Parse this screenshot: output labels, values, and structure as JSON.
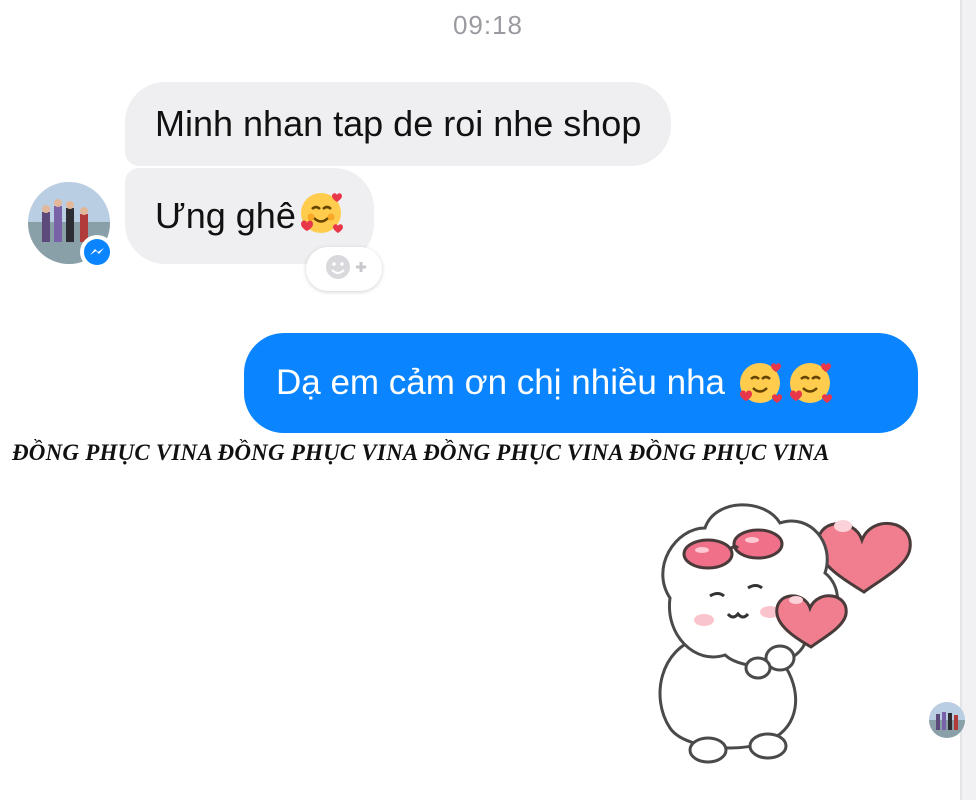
{
  "conversation": {
    "timestamp": "09:18",
    "incoming": [
      {
        "text": "Minh nhan tap de roi nhe shop"
      },
      {
        "text": "Ưng ghê",
        "emoji": "smiling-face-with-hearts"
      }
    ],
    "outgoing": [
      {
        "text": "Dạ em cảm ơn chị nhiều nha",
        "emoji": [
          "smiling-face-with-hearts",
          "smiling-face-with-hearts"
        ]
      }
    ],
    "react_button": {
      "icon": "smiley-add-icon",
      "symbol": "+"
    }
  },
  "watermark": {
    "text": "ĐỒNG PHỤC VINA ĐỒNG PHỤC VINA ĐỒNG PHỤC VINA ĐỒNG PHỤC VINA"
  },
  "colors": {
    "outgoing_bubble": "#0a84ff",
    "incoming_bubble": "#efeff1",
    "timestamp": "#9a9aa0",
    "messenger_badge": "#0a84ff"
  },
  "sticker": {
    "name": "white-puppy-with-hearts-sticker"
  }
}
